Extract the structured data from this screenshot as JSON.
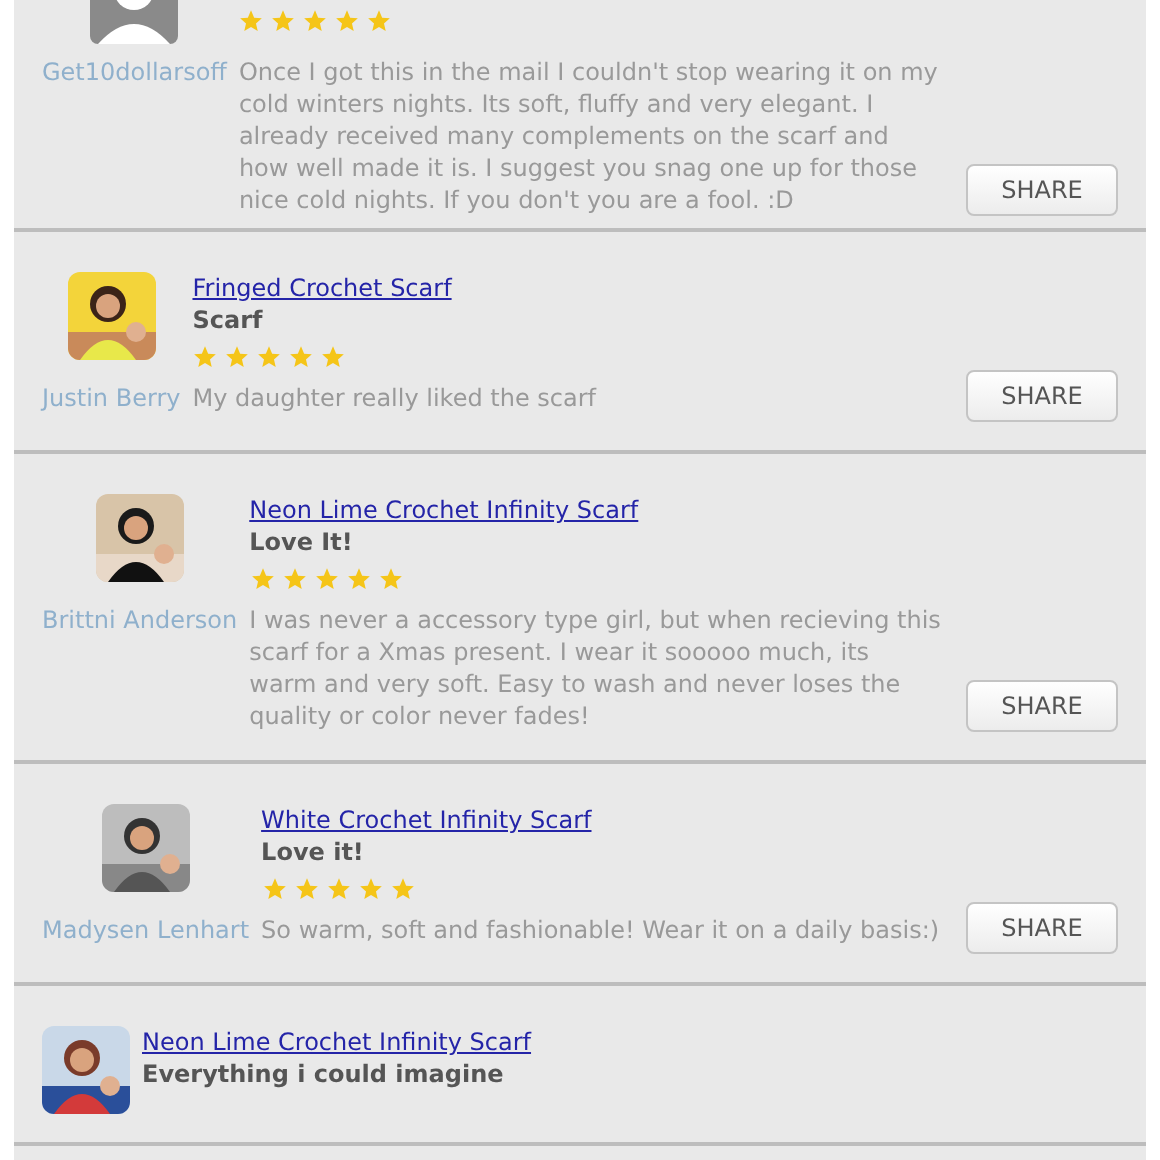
{
  "reviews": [
    {
      "avatar": {
        "kind": "default"
      },
      "user": "Get10dollarsoff",
      "stars": 5,
      "body": "Once I got this in the mail I couldn't stop wearing it on my cold winters nights. Its soft, fluffy and very elegant. I already received many complements on the scarf and how well made it is. I suggest you snag one up for those nice cold nights. If you don't you are a fool. :D",
      "share": "SHARE"
    },
    {
      "user": "Justin Berry",
      "product": "Fringed Crochet Scarf",
      "title": "Scarf",
      "stars": 5,
      "body": "My daughter really liked the scarf",
      "share": "SHARE"
    },
    {
      "user": "Brittni Anderson",
      "product": "Neon Lime Crochet Infinity Scarf",
      "title": "Love It!",
      "stars": 5,
      "body": "I was never a accessory type girl, but when recieving this scarf for a Xmas present. I wear it sooooo much, its warm and very soft. Easy to wash and never loses the quality or color never fades!",
      "share": "SHARE"
    },
    {
      "user": "Madysen Lenhart",
      "product": "White Crochet Infinity Scarf",
      "title": "Love it!",
      "stars": 5,
      "body": "So warm, soft and fashionable! Wear it on a daily basis:)",
      "share": "SHARE"
    },
    {
      "product": "Neon Lime Crochet Infinity Scarf",
      "title": "Everything i could imagine"
    }
  ]
}
